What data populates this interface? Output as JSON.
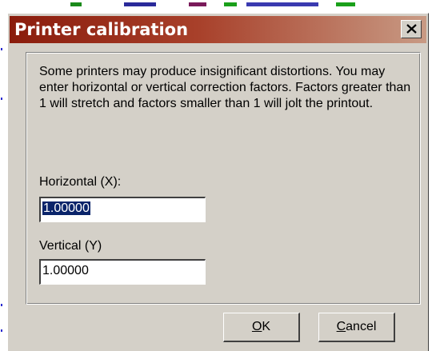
{
  "window": {
    "title": "Printer calibration",
    "close_glyph": "close-icon"
  },
  "description": "Some printers may produce insignificant distortions. You may enter horizontal or vertical correction factors. Factors greater than 1 will stretch and factors smaller than 1 will jolt the printout.",
  "horizontal": {
    "label": "Horizontal (X):",
    "value": "1.00000"
  },
  "vertical": {
    "label": "Vertical (Y)",
    "value": "1.00000"
  },
  "buttons": {
    "ok": {
      "mnemonic": "O",
      "rest": "K"
    },
    "cancel": {
      "mnemonic": "C",
      "rest": "ancel"
    }
  },
  "colors": {
    "title_gradient_start": "#8a1c0c",
    "title_gradient_end": "#c89a84",
    "dialog_face": "#d4d0c8",
    "selection": "#0a246a"
  }
}
